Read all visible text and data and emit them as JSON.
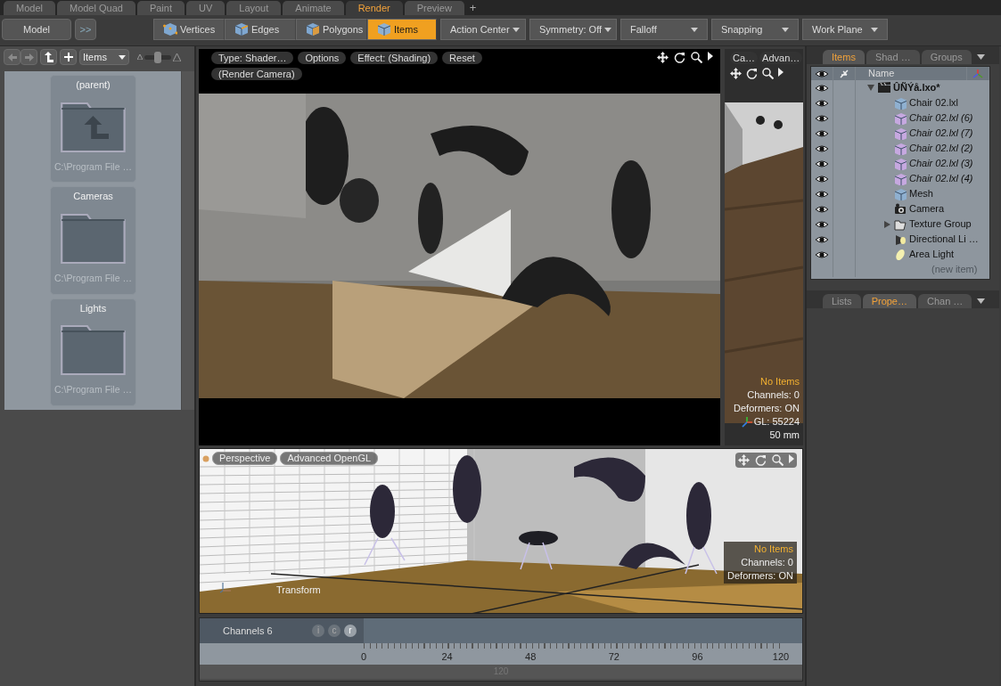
{
  "workspace_tabs": [
    {
      "label": "Model",
      "selected": false
    },
    {
      "label": "Model Quad",
      "selected": false
    },
    {
      "label": "Paint",
      "selected": false
    },
    {
      "label": "UV",
      "selected": false
    },
    {
      "label": "Layout",
      "selected": false
    },
    {
      "label": "Animate",
      "selected": false
    },
    {
      "label": "Render",
      "selected": true
    },
    {
      "label": "Preview",
      "selected": false
    }
  ],
  "add_tab": "+",
  "toolbar": {
    "left_buttons": [
      "Model",
      ">>"
    ],
    "modes": [
      {
        "label": "Vertices",
        "kind": "vertices",
        "selected": false
      },
      {
        "label": "Edges",
        "kind": "edges",
        "selected": false
      },
      {
        "label": "Polygons",
        "kind": "polygons",
        "selected": false
      },
      {
        "label": "Items",
        "kind": "items",
        "selected": true
      }
    ],
    "dropdowns": [
      "Action Center",
      "Symmetry: Off",
      "Falloff",
      "Snapping",
      "Work Plane"
    ]
  },
  "browser": {
    "filter": "Items",
    "size_slider": {
      "level": 0.5
    },
    "tiles": [
      {
        "kind": "parent",
        "title": "(parent)",
        "path": "C:\\Program File …"
      },
      {
        "kind": "folder",
        "title": "Cameras",
        "path": "C:\\Program File …"
      },
      {
        "kind": "folder",
        "title": "Lights",
        "path": "C:\\Program File …"
      }
    ]
  },
  "render_view": {
    "buttons": [
      "Type: Shader…",
      "Options",
      "Effect: (Shading)",
      "Reset",
      "(Render Camera)"
    ]
  },
  "camera_view": {
    "buttons": [
      "Ca…",
      "Advan…"
    ],
    "info": [
      {
        "text": "No Items",
        "highlight": true
      },
      {
        "text": "Channels: 0",
        "highlight": false
      },
      {
        "text": "Deformers: ON",
        "highlight": false
      },
      {
        "text": "GL: 55224",
        "highlight": false
      },
      {
        "text": "50 mm",
        "highlight": false
      }
    ]
  },
  "items_panel": {
    "tabs": [
      {
        "label": "Items",
        "selected": true
      },
      {
        "label": "Shad …",
        "selected": false
      },
      {
        "label": "Groups",
        "selected": false
      }
    ],
    "header": "Name",
    "tree": [
      {
        "name": "ÛÑÝå.lxo*",
        "kind": "scene",
        "expanded": true,
        "children": [
          {
            "name": "Chair 02.lxl",
            "kind": "mesh"
          },
          {
            "name": "Chair 02.lxl (6)",
            "kind": "instance"
          },
          {
            "name": "Chair 02.lxl (7)",
            "kind": "instance"
          },
          {
            "name": "Chair 02.lxl (2)",
            "kind": "instance"
          },
          {
            "name": "Chair 02.lxl (3)",
            "kind": "instance"
          },
          {
            "name": "Chair 02.lxl (4)",
            "kind": "instance"
          },
          {
            "name": "Mesh",
            "kind": "mesh"
          },
          {
            "name": "Camera",
            "kind": "camera"
          },
          {
            "name": "Texture Group",
            "kind": "group",
            "expanded": false
          },
          {
            "name": "Directional Li …",
            "kind": "directional_light"
          },
          {
            "name": "Area Light",
            "kind": "area_light"
          }
        ]
      }
    ],
    "placeholder": "(new item)"
  },
  "properties_panel": {
    "tabs": [
      {
        "label": "Lists",
        "selected": false
      },
      {
        "label": "Prope…",
        "selected": true
      },
      {
        "label": "Chan …",
        "selected": false
      }
    ]
  },
  "perspective_view": {
    "buttons": [
      "Perspective",
      "Advanced OpenGL"
    ],
    "tool": "Transform",
    "info": [
      {
        "text": "No Items",
        "highlight": true
      },
      {
        "text": "Channels: 0",
        "highlight": false
      },
      {
        "text": "Deformers: ON",
        "highlight": false
      }
    ]
  },
  "timeline": {
    "label": "Channels 6",
    "toggles": [
      {
        "label": "i",
        "on": false
      },
      {
        "label": "c",
        "on": false
      },
      {
        "label": "r",
        "on": true
      }
    ],
    "ticks": [
      "0",
      "24",
      "48",
      "72",
      "96",
      "120"
    ],
    "range_end": "120"
  }
}
